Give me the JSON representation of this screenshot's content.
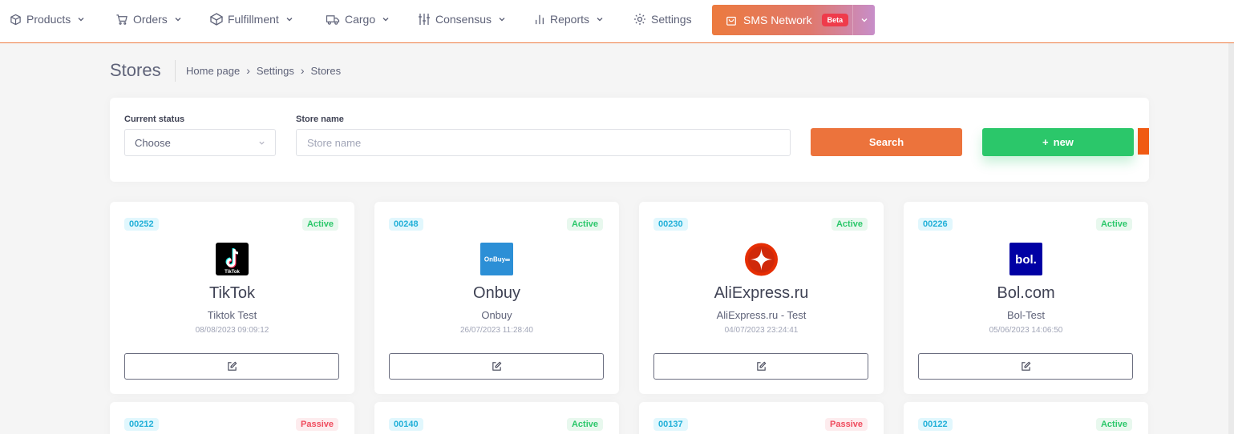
{
  "nav": {
    "products": "Products",
    "orders": "Orders",
    "fulfillment": "Fulfillment",
    "cargo": "Cargo",
    "consensus": "Consensus",
    "reports": "Reports",
    "settings": "Settings",
    "sms_network": "SMS Network",
    "sms_badge": "Beta"
  },
  "page": {
    "title": "Stores",
    "breadcrumb": [
      "Home page",
      "Settings",
      "Stores"
    ]
  },
  "filters": {
    "status_label": "Current status",
    "status_value": "Choose",
    "store_name_label": "Store name",
    "store_name_placeholder": "Store name",
    "store_name_value": "",
    "search_button": "Search",
    "new_button": "new"
  },
  "stores": [
    {
      "code": "00252",
      "status": "Active",
      "name": "TikTok",
      "subtitle": "Tiktok Test",
      "date": "08/08/2023 09:09:12",
      "logo": "tiktok-logo",
      "logo_text": "TikTok"
    },
    {
      "code": "00248",
      "status": "Active",
      "name": "Onbuy",
      "subtitle": "Onbuy",
      "date": "26/07/2023 11:28:40",
      "logo": "onbuy-logo",
      "logo_text": "OnBuy"
    },
    {
      "code": "00230",
      "status": "Active",
      "name": "AliExpress.ru",
      "subtitle": "AliExpress.ru - Test",
      "date": "04/07/2023 23:24:41",
      "logo": "aliexpress-logo"
    },
    {
      "code": "00226",
      "status": "Active",
      "name": "Bol.com",
      "subtitle": "Bol-Test",
      "date": "05/06/2023 14:06:50",
      "logo": "bol-logo",
      "logo_text": "bol."
    },
    {
      "code": "00212",
      "status": "Passive"
    },
    {
      "code": "00140",
      "status": "Active"
    },
    {
      "code": "00137",
      "status": "Passive"
    },
    {
      "code": "00122",
      "status": "Active"
    }
  ],
  "colors": {
    "accent_orange": "#ec733c",
    "accent_green": "#2bc76a",
    "badge_blue": "#22b0d8",
    "passive_red": "#ef4b5d"
  }
}
